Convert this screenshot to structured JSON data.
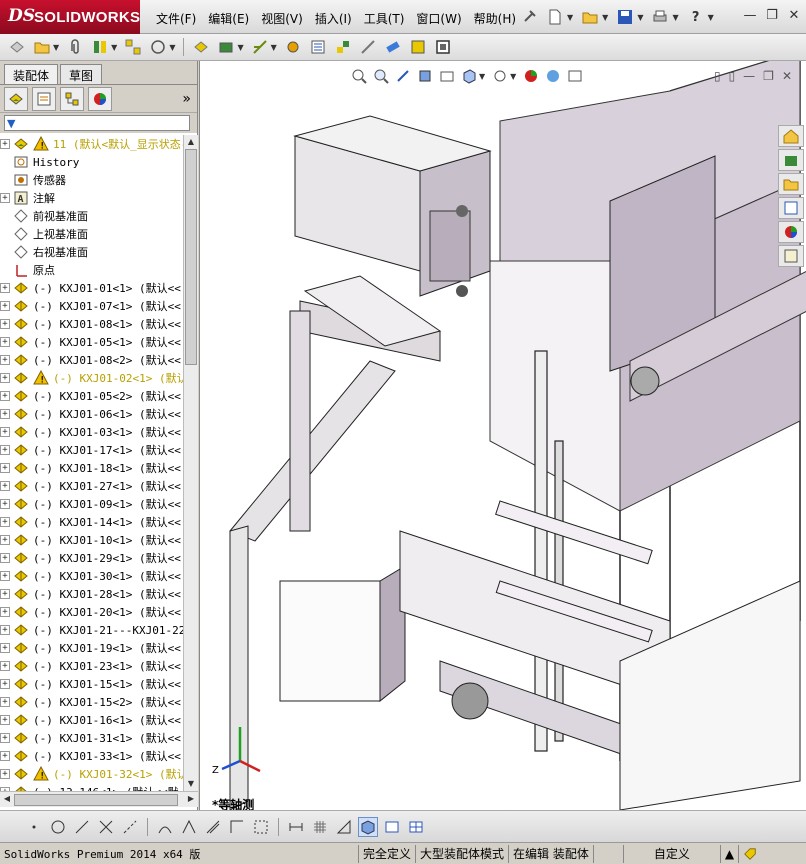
{
  "app": {
    "logo_ds": "DS",
    "logo_name": "SOLIDWORKS"
  },
  "menu": [
    "文件(F)",
    "编辑(E)",
    "视图(V)",
    "插入(I)",
    "工具(T)",
    "窗口(W)",
    "帮助(H)"
  ],
  "panel": {
    "tabs": [
      "装配体",
      "草图"
    ],
    "active_tab": "装配体"
  },
  "tree": [
    {
      "exp": "+",
      "icon": "assembly-icon",
      "warn": true,
      "label": "11  (默认<默认_显示状态-"
    },
    {
      "exp": "",
      "icon": "history-icon",
      "label": "History"
    },
    {
      "exp": "",
      "icon": "sensor-icon",
      "label": "传感器"
    },
    {
      "exp": "+",
      "icon": "annotation-icon",
      "label": "注解"
    },
    {
      "exp": "",
      "icon": "plane-icon",
      "label": "前视基准面"
    },
    {
      "exp": "",
      "icon": "plane-icon",
      "label": "上视基准面"
    },
    {
      "exp": "",
      "icon": "plane-icon",
      "label": "右视基准面"
    },
    {
      "exp": "",
      "icon": "origin-icon",
      "label": "原点"
    },
    {
      "exp": "+",
      "icon": "part-icon",
      "label": "(-) KXJ01-01<1> (默认<<"
    },
    {
      "exp": "+",
      "icon": "part-icon",
      "label": "(-) KXJ01-07<1> (默认<<"
    },
    {
      "exp": "+",
      "icon": "part-icon",
      "label": "(-) KXJ01-08<1> (默认<<"
    },
    {
      "exp": "+",
      "icon": "part-icon",
      "label": "(-) KXJ01-05<1> (默认<<"
    },
    {
      "exp": "+",
      "icon": "part-icon",
      "label": "(-) KXJ01-08<2> (默认<<"
    },
    {
      "exp": "+",
      "icon": "part-icon",
      "warn": true,
      "label": "(-) KXJ01-02<1> (默认"
    },
    {
      "exp": "+",
      "icon": "part-icon",
      "label": "(-) KXJ01-05<2> (默认<<"
    },
    {
      "exp": "+",
      "icon": "part-icon",
      "label": "(-) KXJ01-06<1> (默认<<"
    },
    {
      "exp": "+",
      "icon": "part-icon",
      "label": "(-) KXJ01-03<1> (默认<<"
    },
    {
      "exp": "+",
      "icon": "part-icon",
      "label": "(-) KXJ01-17<1> (默认<<"
    },
    {
      "exp": "+",
      "icon": "part-icon",
      "label": "(-) KXJ01-18<1> (默认<<"
    },
    {
      "exp": "+",
      "icon": "part-icon",
      "label": "(-) KXJ01-27<1> (默认<<"
    },
    {
      "exp": "+",
      "icon": "part-icon",
      "label": "(-) KXJ01-09<1> (默认<<"
    },
    {
      "exp": "+",
      "icon": "part-icon",
      "label": "(-) KXJ01-14<1> (默认<<"
    },
    {
      "exp": "+",
      "icon": "part-icon",
      "label": "(-) KXJ01-10<1> (默认<<"
    },
    {
      "exp": "+",
      "icon": "part-icon",
      "label": "(-) KXJ01-29<1> (默认<<"
    },
    {
      "exp": "+",
      "icon": "part-icon",
      "label": "(-) KXJ01-30<1> (默认<<"
    },
    {
      "exp": "+",
      "icon": "part-icon",
      "label": "(-) KXJ01-28<1> (默认<<"
    },
    {
      "exp": "+",
      "icon": "part-icon",
      "label": "(-) KXJ01-20<1> (默认<<"
    },
    {
      "exp": "+",
      "icon": "part-icon",
      "label": "(-) KXJ01-21---KXJ01-22"
    },
    {
      "exp": "+",
      "icon": "part-icon",
      "label": "(-) KXJ01-19<1> (默认<<"
    },
    {
      "exp": "+",
      "icon": "part-icon",
      "label": "(-) KXJ01-23<1> (默认<<"
    },
    {
      "exp": "+",
      "icon": "part-icon",
      "label": "(-) KXJ01-15<1> (默认<<"
    },
    {
      "exp": "+",
      "icon": "part-icon",
      "label": "(-) KXJ01-15<2> (默认<<"
    },
    {
      "exp": "+",
      "icon": "part-icon",
      "label": "(-) KXJ01-16<1> (默认<<"
    },
    {
      "exp": "+",
      "icon": "part-icon",
      "label": "(-) KXJ01-31<1> (默认<<"
    },
    {
      "exp": "+",
      "icon": "part-icon",
      "label": "(-) KXJ01-33<1> (默认<<"
    },
    {
      "exp": "+",
      "icon": "part-icon",
      "warn": true,
      "label": "(-) KXJ01-32<1> (默认"
    },
    {
      "exp": "+",
      "icon": "part-icon",
      "label": "(-) 13-146<1> (默认<<默"
    }
  ],
  "viewport": {
    "view_label": "*等轴测",
    "axis_z": "Z"
  },
  "status": {
    "app_version": "SolidWorks Premium 2014 x64 版",
    "definition": "完全定义",
    "mode": "大型装配体模式",
    "editing": "在编辑 装配体",
    "custom": "自定义"
  },
  "colors": {
    "brand_red": "#c8102e",
    "part_yellow": "#e8c800",
    "warning_yellow": "#f0c000",
    "model_purple": "#c9bfcc"
  }
}
